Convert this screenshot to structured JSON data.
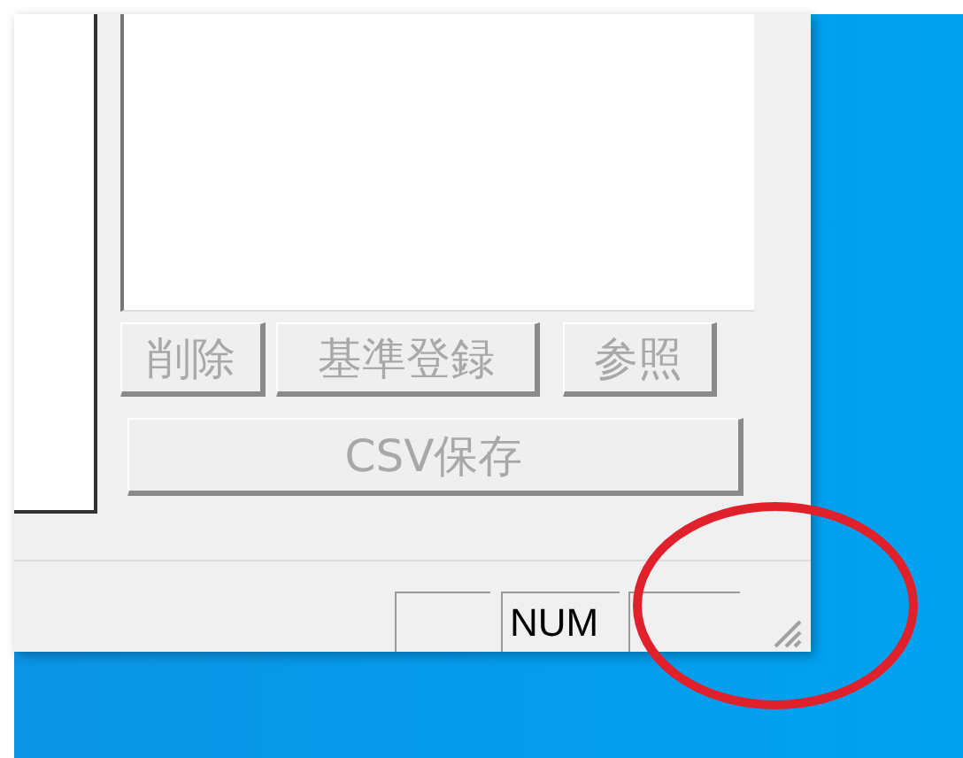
{
  "buttons": [
    {
      "label": "削除",
      "disabled": true
    },
    {
      "label": "基準登録",
      "disabled": true
    },
    {
      "label": "参照",
      "disabled": true
    }
  ],
  "save_button": {
    "label": "CSV保存",
    "disabled": true
  },
  "status_bar": {
    "panes": [
      {
        "kind": "empty"
      },
      {
        "kind": "text",
        "text": "NUM"
      },
      {
        "kind": "empty"
      }
    ]
  }
}
